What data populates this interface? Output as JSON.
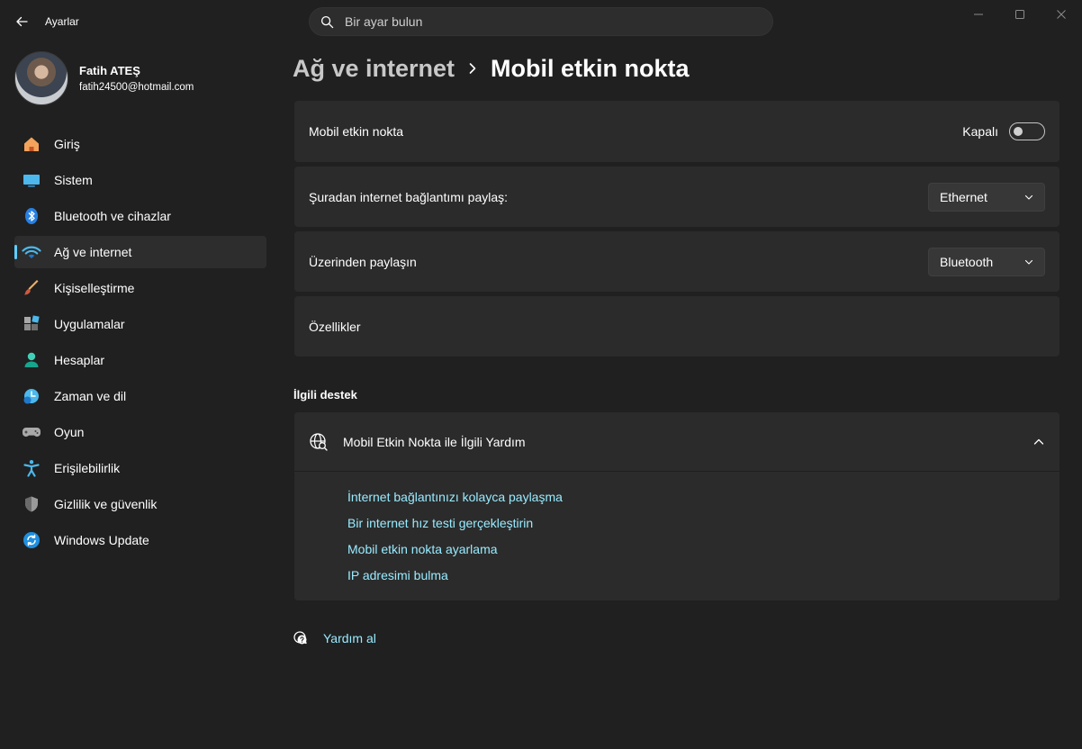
{
  "app": {
    "title": "Ayarlar"
  },
  "search": {
    "placeholder": "Bir ayar bulun"
  },
  "user": {
    "name": "Fatih ATEŞ",
    "email": "fatih24500@hotmail.com"
  },
  "sidebar": {
    "items": [
      {
        "label": "Giriş",
        "icon": "home-icon"
      },
      {
        "label": "Sistem",
        "icon": "monitor-icon"
      },
      {
        "label": "Bluetooth ve cihazlar",
        "icon": "bluetooth-icon"
      },
      {
        "label": "Ağ ve internet",
        "icon": "wifi-icon",
        "active": true
      },
      {
        "label": "Kişiselleştirme",
        "icon": "brush-icon"
      },
      {
        "label": "Uygulamalar",
        "icon": "apps-icon"
      },
      {
        "label": "Hesaplar",
        "icon": "person-icon"
      },
      {
        "label": "Zaman ve dil",
        "icon": "clock-globe-icon"
      },
      {
        "label": "Oyun",
        "icon": "gamepad-icon"
      },
      {
        "label": "Erişilebilirlik",
        "icon": "accessibility-icon"
      },
      {
        "label": "Gizlilik ve güvenlik",
        "icon": "shield-icon"
      },
      {
        "label": "Windows Update",
        "icon": "update-icon"
      }
    ]
  },
  "breadcrumb": {
    "parent": "Ağ ve internet",
    "current": "Mobil etkin nokta"
  },
  "settings": {
    "hotspot": {
      "label": "Mobil etkin nokta",
      "state_label": "Kapalı",
      "enabled": false
    },
    "share_from": {
      "label": "Şuradan internet bağlantımı paylaş:",
      "value": "Ethernet"
    },
    "share_over": {
      "label": "Üzerinden paylaşın",
      "value": "Bluetooth"
    },
    "properties": {
      "label": "Özellikler"
    }
  },
  "related": {
    "title": "İlgili destek",
    "help_title": "Mobil Etkin Nokta ile İlgili Yardım",
    "links": [
      "İnternet bağlantınızı kolayca paylaşma",
      "Bir internet hız testi gerçekleştirin",
      "Mobil etkin nokta ayarlama",
      "IP adresimi bulma"
    ]
  },
  "get_help": {
    "label": "Yardım al"
  },
  "colors": {
    "background": "#202020",
    "card": "#2b2b2b",
    "accent": "#60cdff",
    "link": "#99ebff"
  }
}
